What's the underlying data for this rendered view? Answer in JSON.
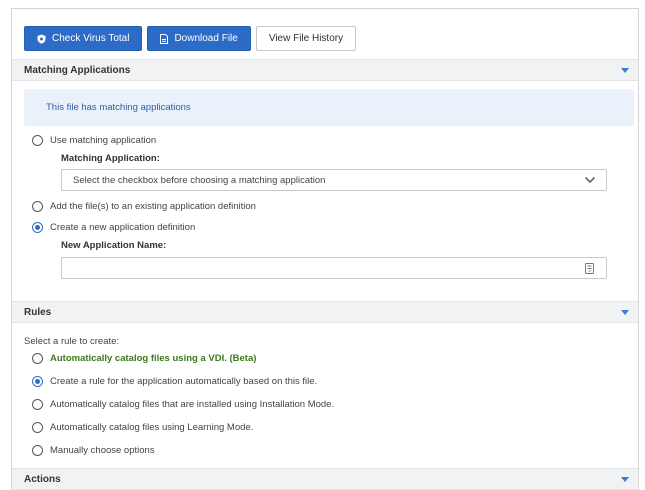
{
  "toolbar": {
    "check_virus_total": "Check Virus Total",
    "download_file": "Download File",
    "view_file_history": "View File History"
  },
  "matching": {
    "header": "Matching Applications",
    "info": "This file has matching applications",
    "use_matching_label": "Use matching application",
    "matching_app_label": "Matching Application:",
    "select_placeholder": "Select the checkbox before choosing a matching application",
    "add_existing_label": "Add the file(s) to an existing application definition",
    "create_new_label": "Create a new application definition",
    "new_app_name_label": "New Application Name:",
    "new_app_name_value": "",
    "selected": "create_new"
  },
  "rules": {
    "header": "Rules",
    "prompt": "Select a rule to create:",
    "options": [
      "Automatically catalog files using a VDI. (Beta)",
      "Create a rule for the application automatically based on this file.",
      "Automatically catalog files that are installed using Installation Mode.",
      "Automatically catalog files using Learning Mode.",
      "Manually choose options"
    ],
    "selected_index": 1
  },
  "actions": {
    "header": "Actions"
  },
  "colors": {
    "primary": "#2d6cc6",
    "green_text": "#3c7a1e",
    "info_bg": "#eaf1fb",
    "header_bg": "#f1f2f4"
  },
  "icons": {
    "virus_button": "shield-icon",
    "download_button": "file-icon",
    "select": "chevron-down-icon",
    "text_input": "keyboard-icon",
    "section": "caret-down-icon"
  }
}
